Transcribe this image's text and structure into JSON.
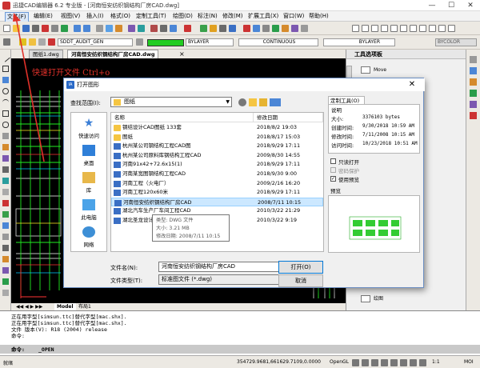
{
  "titlebar": {
    "title": "迅捷CAD编辑器 6.2 专业版 - [河南恒安纺织钢结构厂房CAD.dwg]",
    "minimize": "—",
    "maximize": "☐",
    "close": "✕"
  },
  "menu": [
    "文件(F)",
    "编辑(E)",
    "视图(V)",
    "插入(I)",
    "格式(O)",
    "定制工具(T)",
    "绘图(D)",
    "标注(N)",
    "修改(M)",
    "扩展工具(X)",
    "窗口(W)",
    "帮助(H)"
  ],
  "toolbar": {
    "layer_combo": "SDDT_AUDIT_GEN",
    "color_combo": "BYLAYER",
    "linetype_combo": "CONTINUOUS",
    "lineweight_combo": "BYLAYER",
    "plotstyle_combo": "BYCOLOR"
  },
  "tabs": {
    "doc1": "图纸1.dwg",
    "doc2": "河南恒安纺织钢结构厂房CAD.dwg",
    "close": "×"
  },
  "canvas": {
    "hint": "快速打开文件   Ctrl+o"
  },
  "layout_tabs": {
    "model": "Model",
    "layout": "布局1"
  },
  "palette": {
    "title": "工具选项板",
    "items": [
      "Move",
      "绘图"
    ]
  },
  "dialog": {
    "title": "打开图形",
    "look_in_label": "查找范围(I):",
    "look_in_value": "图纸",
    "places": [
      "快速访问",
      "桌面",
      "库",
      "此电脑",
      "网络"
    ],
    "columns": {
      "name": "名称",
      "date": "修改日期"
    },
    "files": [
      {
        "name": "钢结设计CAD图纸 133套",
        "date": "2018/8/2 19:03",
        "type": "folder"
      },
      {
        "name": "图纸",
        "date": "2018/8/17 15:03",
        "type": "folder"
      },
      {
        "name": "杭州某公司钢结构工程CAD图",
        "date": "2018/9/29 17:11",
        "type": "dwg"
      },
      {
        "name": "杭州某公司原料库钢结构工程CAD",
        "date": "2009/8/30 14:55",
        "type": "dwg"
      },
      {
        "name": "河南91x42+72.6x15(1)",
        "date": "2018/9/29 17:11",
        "type": "dwg"
      },
      {
        "name": "河南某宽图钢结构工程CAD",
        "date": "2018/9/30 9:00",
        "type": "dwg"
      },
      {
        "name": "河南工程（火电厂）",
        "date": "2009/2/16 16:20",
        "type": "dwg"
      },
      {
        "name": "河南工程120x60米",
        "date": "2018/9/29 17:11",
        "type": "dwg"
      },
      {
        "name": "河南恒安纺织钢结构厂房CAD",
        "date": "2008/7/11 10:15",
        "type": "dwg",
        "selected": true
      },
      {
        "name": "湖北汽车生产厂车间工程CAD",
        "date": "2010/3/22 21:29",
        "type": "dwg"
      },
      {
        "name": "湖北圣龙设计",
        "date": "2010/3/22 9:19",
        "type": "dwg"
      }
    ],
    "tooltip": {
      "type": "类型: DWG 文件",
      "size": "大小: 3.21 MB",
      "modified": "修改日期: 2008/7/11 10:15"
    },
    "info": {
      "tab": "定制工具(O)",
      "section": "说明",
      "size_label": "大小:",
      "size_value": "3376103 bytes",
      "created_label": "创建时间:",
      "created_value": "9/30/2018 10:59 AM",
      "modified_label": "修改时间:",
      "modified_value": "7/11/2008 10:15 AM",
      "accessed_label": "访问时间:",
      "accessed_value": "10/23/2018 10:51 AM",
      "readonly": "只读打开",
      "password": "密码保护",
      "use_preview": "使用预览",
      "preview_label": "预览"
    },
    "filename_label": "文件名(N):",
    "filename_value": "河南恒安纺织钢结构厂房CAD",
    "filetype_label": "文件类型(T):",
    "filetype_value": "标准图文件 (*.dwg)",
    "open_button": "打开(O)",
    "cancel_button": "取消"
  },
  "command": {
    "lines": [
      "正在用字型[simsun.ttc]替代字型[mac.shx].",
      "正在用字型[simsun.ttc]替代字型[mac.shx].",
      "文件 版本(V): R18 (2004) release",
      "命令:"
    ],
    "prompt_label": "命令:",
    "prompt_value": "_OPEN"
  },
  "status": {
    "left": "就绪",
    "coords": "354729.9681,661629.7109,0.0000",
    "opengl": "OpenGL",
    "scale": "1:1",
    "mode": "MOI"
  }
}
